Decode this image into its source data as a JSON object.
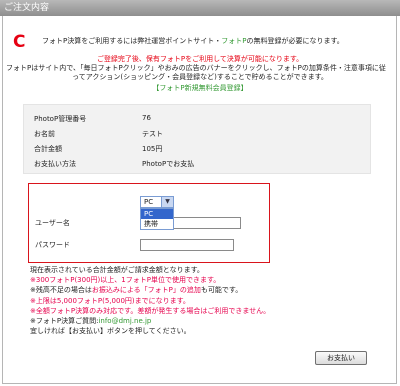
{
  "header": {
    "title": "ご注文内容"
  },
  "logo": {
    "letter": "C"
  },
  "intro": {
    "line1_pre": "フォトP決算をご利用するには弊社運営ポイントサイト・",
    "line1_brand": "フォトP",
    "line1_post": "の無料登録が必要になります。",
    "line2": "ご登録完了後、保有フォトPをご利用して決算が可能になります。",
    "line3": "フォトPはサイト内で、「毎日フォトPクリック」やおみの広告のバナーをクリックし、フォトPの加算条件・注意事項に従",
    "line4": "ってアクション(ショッピング・会員登録など)することで貯めることができます。",
    "register_link": "【フォトP新規無料会員登録】"
  },
  "order": {
    "rows": [
      {
        "label": "PhotoP管理番号",
        "value": "76"
      },
      {
        "label": "お名前",
        "value": "テスト"
      },
      {
        "label": "合計金額",
        "value": "105円"
      },
      {
        "label": "お支払い方法",
        "value": "PhotoPでお支払"
      }
    ]
  },
  "login": {
    "select_value": "PC",
    "options": [
      "PC",
      "携帯"
    ],
    "username_label": "ユーザー名",
    "password_label": "パスワード",
    "username_value": "",
    "password_value": ""
  },
  "notes": {
    "n1": "現在表示されている合計金額がご請求金額となります。",
    "n2": "※300フォトP(300円)以上、1フォトP単位で使用できます。",
    "n3_pre": "※残高不足の場合は",
    "n3_link": "お振込みによる「フォトP」の追加",
    "n3_post": "も可能です。",
    "n4": "※上限は5,000フォトP(5,000円)までになります。",
    "n5": "※全額フォトP決算のみ対応です。差額が発生する場合はご利用できません。",
    "n6_pre": "※フォトP決算ご質問:",
    "n6_email": "info@dmj.ne.jp",
    "n7": "宜しければ【お支払い】ボタンを押してください。"
  },
  "pay_button": {
    "label": "お支払い"
  },
  "colors": {
    "accent": "#e60012",
    "brand_green": "#339933",
    "border_red": "#d9141c"
  }
}
